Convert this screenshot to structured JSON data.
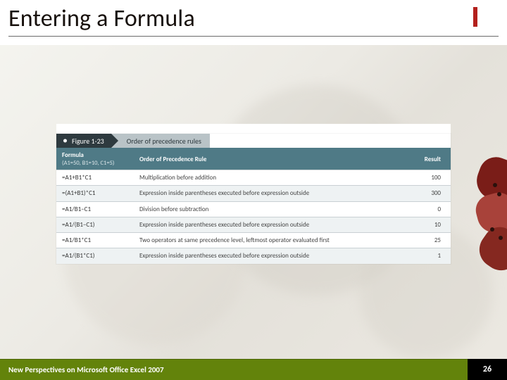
{
  "title": "Entering a Formula",
  "figure": {
    "label": "Figure 1-23",
    "caption": "Order of precedence rules"
  },
  "table": {
    "headers": {
      "formula": "Formula",
      "formula_sub": "(A1=50, B1=10, C1=5)",
      "rule": "Order of Precedence Rule",
      "result": "Result"
    },
    "rows": [
      {
        "formula": "=A1+B1*C1",
        "rule": "Multiplication before addition",
        "result": "100",
        "tint": false
      },
      {
        "formula": "=(A1+B1)*C1",
        "rule": "Expression inside parentheses executed before expression outside",
        "result": "300",
        "tint": true
      },
      {
        "formula": "=A1/B1−C1",
        "rule": "Division before subtraction",
        "result": "0",
        "tint": false
      },
      {
        "formula": "=A1/(B1−C1)",
        "rule": "Expression inside parentheses executed before expression outside",
        "result": "10",
        "tint": true
      },
      {
        "formula": "=A1/B1*C1",
        "rule": "Two operators at same precedence level, leftmost operator evaluated first",
        "result": "25",
        "tint": false
      },
      {
        "formula": "=A1/(B1*C1)",
        "rule": "Expression inside parentheses executed before expression outside",
        "result": "1",
        "tint": true
      }
    ]
  },
  "footer": {
    "text": "New Perspectives on Microsoft Office Excel 2007",
    "page": "26"
  }
}
